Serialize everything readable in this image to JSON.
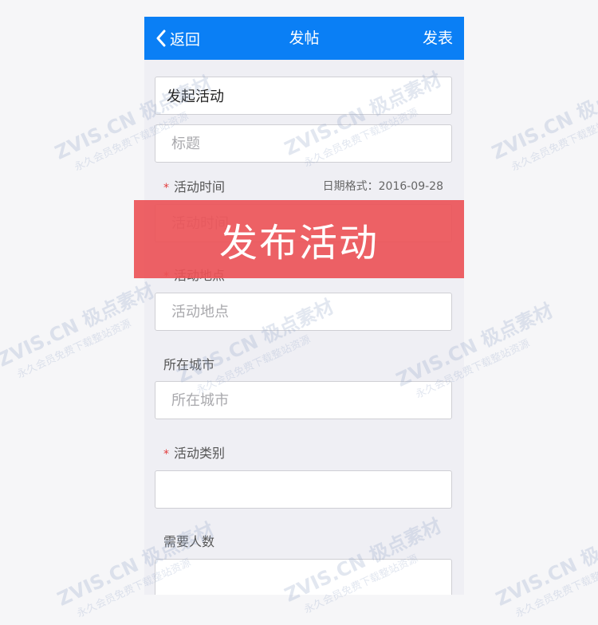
{
  "navbar": {
    "back_label": "返回",
    "title": "发帖",
    "publish_label": "发表"
  },
  "form": {
    "category_value": "发起活动",
    "title_placeholder": "标题",
    "time_label": "活动时间",
    "date_hint": "日期格式：2016-09-28",
    "time_placeholder": "活动时间",
    "location_label": "活动地点",
    "location_placeholder": "活动地点",
    "city_label": "所在城市",
    "city_placeholder": "所在城市",
    "type_label": "活动类别",
    "type_value": "",
    "people_label": "需要人数",
    "people_value": "",
    "required_mark": "*"
  },
  "banner": {
    "text": "发布活动"
  },
  "watermark": {
    "line1": "ZVIS.CN 极点素材",
    "line2": "永久会员免费下载整站资源"
  },
  "colors": {
    "navbar": "#0a7ff5",
    "banner": "#ec5458",
    "required": "#e23b3b"
  }
}
